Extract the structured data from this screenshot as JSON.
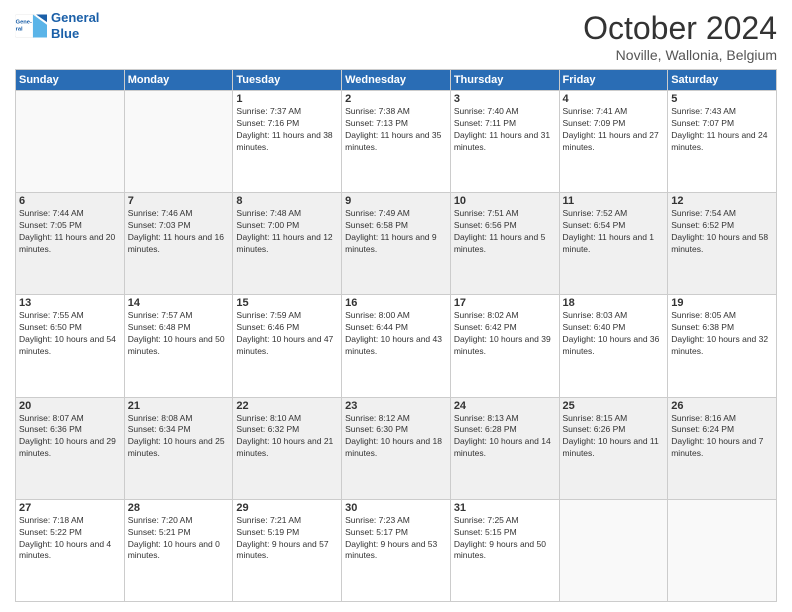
{
  "logo": {
    "line1": "General",
    "line2": "Blue"
  },
  "header": {
    "month": "October 2024",
    "location": "Noville, Wallonia, Belgium"
  },
  "columns": [
    "Sunday",
    "Monday",
    "Tuesday",
    "Wednesday",
    "Thursday",
    "Friday",
    "Saturday"
  ],
  "weeks": [
    {
      "shade": false,
      "days": [
        {
          "num": "",
          "info": ""
        },
        {
          "num": "",
          "info": ""
        },
        {
          "num": "1",
          "info": "Sunrise: 7:37 AM\nSunset: 7:16 PM\nDaylight: 11 hours and 38 minutes."
        },
        {
          "num": "2",
          "info": "Sunrise: 7:38 AM\nSunset: 7:13 PM\nDaylight: 11 hours and 35 minutes."
        },
        {
          "num": "3",
          "info": "Sunrise: 7:40 AM\nSunset: 7:11 PM\nDaylight: 11 hours and 31 minutes."
        },
        {
          "num": "4",
          "info": "Sunrise: 7:41 AM\nSunset: 7:09 PM\nDaylight: 11 hours and 27 minutes."
        },
        {
          "num": "5",
          "info": "Sunrise: 7:43 AM\nSunset: 7:07 PM\nDaylight: 11 hours and 24 minutes."
        }
      ]
    },
    {
      "shade": true,
      "days": [
        {
          "num": "6",
          "info": "Sunrise: 7:44 AM\nSunset: 7:05 PM\nDaylight: 11 hours and 20 minutes."
        },
        {
          "num": "7",
          "info": "Sunrise: 7:46 AM\nSunset: 7:03 PM\nDaylight: 11 hours and 16 minutes."
        },
        {
          "num": "8",
          "info": "Sunrise: 7:48 AM\nSunset: 7:00 PM\nDaylight: 11 hours and 12 minutes."
        },
        {
          "num": "9",
          "info": "Sunrise: 7:49 AM\nSunset: 6:58 PM\nDaylight: 11 hours and 9 minutes."
        },
        {
          "num": "10",
          "info": "Sunrise: 7:51 AM\nSunset: 6:56 PM\nDaylight: 11 hours and 5 minutes."
        },
        {
          "num": "11",
          "info": "Sunrise: 7:52 AM\nSunset: 6:54 PM\nDaylight: 11 hours and 1 minute."
        },
        {
          "num": "12",
          "info": "Sunrise: 7:54 AM\nSunset: 6:52 PM\nDaylight: 10 hours and 58 minutes."
        }
      ]
    },
    {
      "shade": false,
      "days": [
        {
          "num": "13",
          "info": "Sunrise: 7:55 AM\nSunset: 6:50 PM\nDaylight: 10 hours and 54 minutes."
        },
        {
          "num": "14",
          "info": "Sunrise: 7:57 AM\nSunset: 6:48 PM\nDaylight: 10 hours and 50 minutes."
        },
        {
          "num": "15",
          "info": "Sunrise: 7:59 AM\nSunset: 6:46 PM\nDaylight: 10 hours and 47 minutes."
        },
        {
          "num": "16",
          "info": "Sunrise: 8:00 AM\nSunset: 6:44 PM\nDaylight: 10 hours and 43 minutes."
        },
        {
          "num": "17",
          "info": "Sunrise: 8:02 AM\nSunset: 6:42 PM\nDaylight: 10 hours and 39 minutes."
        },
        {
          "num": "18",
          "info": "Sunrise: 8:03 AM\nSunset: 6:40 PM\nDaylight: 10 hours and 36 minutes."
        },
        {
          "num": "19",
          "info": "Sunrise: 8:05 AM\nSunset: 6:38 PM\nDaylight: 10 hours and 32 minutes."
        }
      ]
    },
    {
      "shade": true,
      "days": [
        {
          "num": "20",
          "info": "Sunrise: 8:07 AM\nSunset: 6:36 PM\nDaylight: 10 hours and 29 minutes."
        },
        {
          "num": "21",
          "info": "Sunrise: 8:08 AM\nSunset: 6:34 PM\nDaylight: 10 hours and 25 minutes."
        },
        {
          "num": "22",
          "info": "Sunrise: 8:10 AM\nSunset: 6:32 PM\nDaylight: 10 hours and 21 minutes."
        },
        {
          "num": "23",
          "info": "Sunrise: 8:12 AM\nSunset: 6:30 PM\nDaylight: 10 hours and 18 minutes."
        },
        {
          "num": "24",
          "info": "Sunrise: 8:13 AM\nSunset: 6:28 PM\nDaylight: 10 hours and 14 minutes."
        },
        {
          "num": "25",
          "info": "Sunrise: 8:15 AM\nSunset: 6:26 PM\nDaylight: 10 hours and 11 minutes."
        },
        {
          "num": "26",
          "info": "Sunrise: 8:16 AM\nSunset: 6:24 PM\nDaylight: 10 hours and 7 minutes."
        }
      ]
    },
    {
      "shade": false,
      "days": [
        {
          "num": "27",
          "info": "Sunrise: 7:18 AM\nSunset: 5:22 PM\nDaylight: 10 hours and 4 minutes."
        },
        {
          "num": "28",
          "info": "Sunrise: 7:20 AM\nSunset: 5:21 PM\nDaylight: 10 hours and 0 minutes."
        },
        {
          "num": "29",
          "info": "Sunrise: 7:21 AM\nSunset: 5:19 PM\nDaylight: 9 hours and 57 minutes."
        },
        {
          "num": "30",
          "info": "Sunrise: 7:23 AM\nSunset: 5:17 PM\nDaylight: 9 hours and 53 minutes."
        },
        {
          "num": "31",
          "info": "Sunrise: 7:25 AM\nSunset: 5:15 PM\nDaylight: 9 hours and 50 minutes."
        },
        {
          "num": "",
          "info": ""
        },
        {
          "num": "",
          "info": ""
        }
      ]
    }
  ]
}
